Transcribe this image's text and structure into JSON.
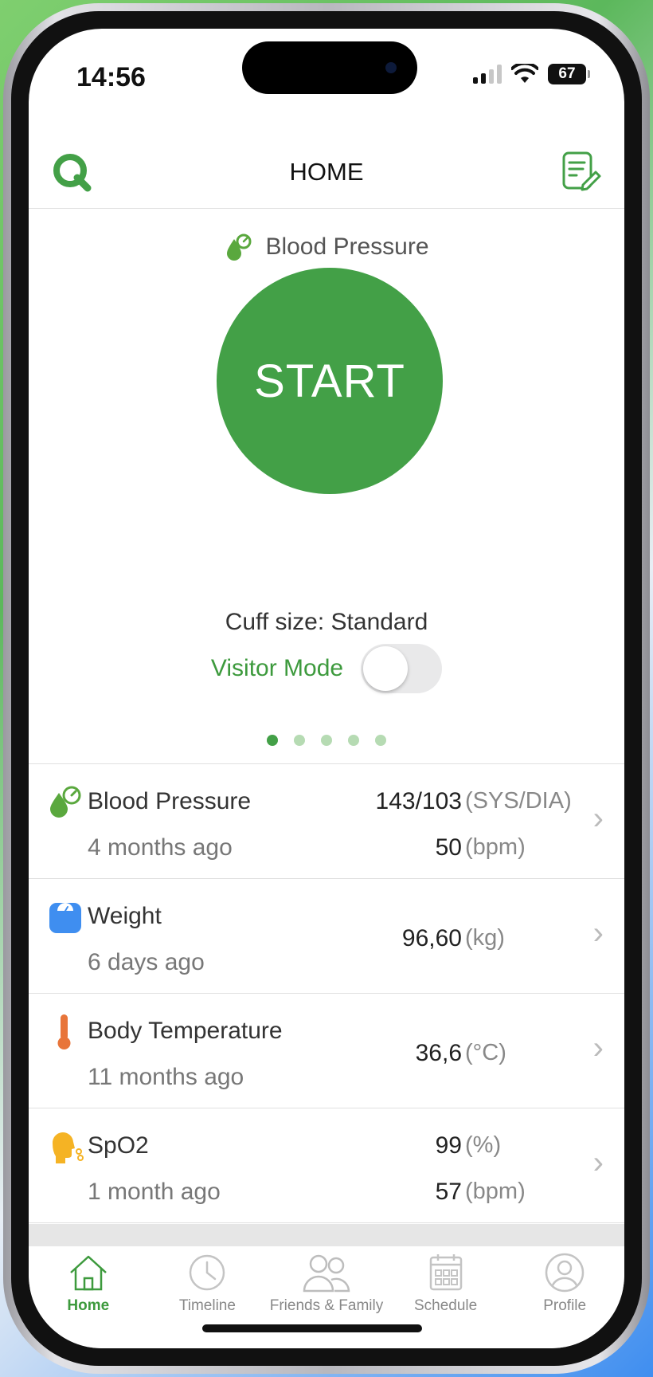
{
  "status_bar": {
    "time": "14:56",
    "battery": "67"
  },
  "nav": {
    "title": "HOME"
  },
  "measure": {
    "type_label": "Blood Pressure",
    "start_label": "START",
    "cuff_text": "Cuff size: Standard",
    "visitor_label": "Visitor Mode",
    "visitor_on": false,
    "page_count": 5,
    "page_index": 1
  },
  "metrics": [
    {
      "title": "Blood Pressure",
      "time": "4 months ago",
      "value1": "143/103",
      "unit1": "(SYS/DIA)",
      "value2": "50",
      "unit2": "(bpm)",
      "icon": "blood-pressure-icon"
    },
    {
      "title": "Weight",
      "time": "6 days ago",
      "value1": "96,60",
      "unit1": "(kg)",
      "icon": "weight-scale-icon"
    },
    {
      "title": "Body Temperature",
      "time": "11 months ago",
      "value1": "36,6",
      "unit1": "(°C)",
      "icon": "thermometer-icon"
    },
    {
      "title": "SpO2",
      "time": "1 month ago",
      "value1": "99",
      "unit1": "(%)",
      "value2": "57",
      "unit2": "(bpm)",
      "icon": "spo2-icon"
    }
  ],
  "tabs": [
    {
      "label": "Home",
      "icon": "home-icon",
      "active": true
    },
    {
      "label": "Timeline",
      "icon": "clock-icon",
      "active": false
    },
    {
      "label": "Friends & Family",
      "icon": "people-icon",
      "active": false
    },
    {
      "label": "Schedule",
      "icon": "calendar-icon",
      "active": false
    },
    {
      "label": "Profile",
      "icon": "profile-icon",
      "active": false
    }
  ],
  "colors": {
    "accent": "#43a047",
    "accent_text": "#3d9a3d",
    "weight_blue": "#3f8ef0",
    "temp_orange": "#e8753a",
    "spo2_yellow": "#f5b324"
  }
}
